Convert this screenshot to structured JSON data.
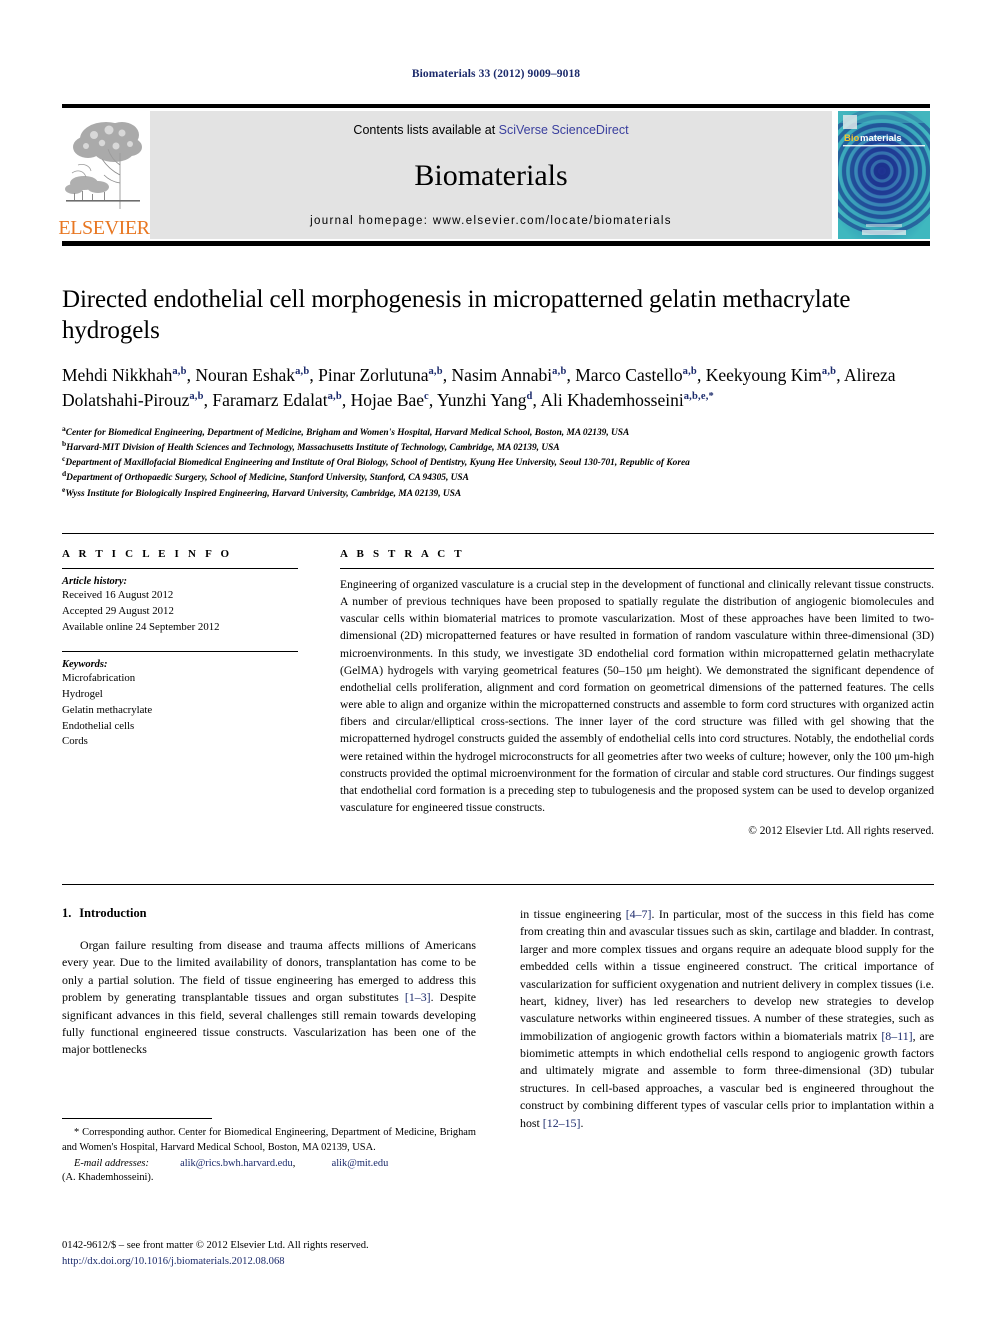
{
  "running_head": "Biomaterials 33 (2012) 9009–9018",
  "masthead": {
    "publisher_name": "ELSEVIER",
    "contents_prefix": "Contents lists available at ",
    "contents_link": "SciVerse ScienceDirect",
    "journal_wordmark": "Biomaterials",
    "homepage": "journal homepage: www.elsevier.com/locate/biomaterials",
    "cover_title_bio": "Bio",
    "cover_title_materials": "materials"
  },
  "article": {
    "title": "Directed endothelial cell morphogenesis in micropatterned gelatin methacrylate hydrogels",
    "authors": [
      {
        "name": "Mehdi Nikkhah",
        "sup": "a,b",
        "sep": ", "
      },
      {
        "name": "Nouran Eshak",
        "sup": "a,b",
        "sep": ", "
      },
      {
        "name": "Pinar Zorlutuna",
        "sup": "a,b",
        "sep": ", "
      },
      {
        "name": "Nasim Annabi",
        "sup": "a,b",
        "sep": ", "
      },
      {
        "name": "Marco Castello",
        "sup": "a,b",
        "sep": ", "
      },
      {
        "name": "Keekyoung Kim",
        "sup": "a,b",
        "sep": ", "
      },
      {
        "name": "Alireza Dolatshahi-Pirouz",
        "sup": "a,b",
        "sep": ", "
      },
      {
        "name": "Faramarz Edalat",
        "sup": "a,b",
        "sep": ", "
      },
      {
        "name": "Hojae Bae",
        "sup": "c",
        "sep": ", "
      },
      {
        "name": "Yunzhi Yang",
        "sup": "d",
        "sep": ", "
      },
      {
        "name": "Ali Khademhosseini",
        "sup": "a,b,e,*",
        "sep": ""
      }
    ],
    "affiliations": [
      {
        "mark": "a",
        "text": "Center for Biomedical Engineering, Department of Medicine, Brigham and Women's Hospital, Harvard Medical School, Boston, MA 02139, USA"
      },
      {
        "mark": "b",
        "text": "Harvard-MIT Division of Health Sciences and Technology, Massachusetts Institute of Technology, Cambridge, MA 02139, USA"
      },
      {
        "mark": "c",
        "text": "Department of Maxillofacial Biomedical Engineering and Institute of Oral Biology, School of Dentistry, Kyung Hee University, Seoul 130-701, Republic of Korea"
      },
      {
        "mark": "d",
        "text": "Department of Orthopaedic Surgery, School of Medicine, Stanford University, Stanford, CA 94305, USA"
      },
      {
        "mark": "e",
        "text": "Wyss Institute for Biologically Inspired Engineering, Harvard University, Cambridge, MA 02139, USA"
      }
    ]
  },
  "article_info": {
    "section_label": "A R T I C L E   I N F O",
    "history_heading": "Article history:",
    "history": [
      "Received 16 August 2012",
      "Accepted 29 August 2012",
      "Available online 24 September 2012"
    ],
    "keywords_heading": "Keywords:",
    "keywords": [
      "Microfabrication",
      "Hydrogel",
      "Gelatin methacrylate",
      "Endothelial cells",
      "Cords"
    ]
  },
  "abstract": {
    "section_label": "A B S T R A C T",
    "text": "Engineering of organized vasculature is a crucial step in the development of functional and clinically relevant tissue constructs. A number of previous techniques have been proposed to spatially regulate the distribution of angiogenic biomolecules and vascular cells within biomaterial matrices to promote vascularization. Most of these approaches have been limited to two-dimensional (2D) micropatterned features or have resulted in formation of random vasculature within three-dimensional (3D) microenvironments. In this study, we investigate 3D endothelial cord formation within micropatterned gelatin methacrylate (GelMA) hydrogels with varying geometrical features (50–150 μm height). We demonstrated the significant dependence of endothelial cells proliferation, alignment and cord formation on geometrical dimensions of the patterned features. The cells were able to align and organize within the micropatterned constructs and assemble to form cord structures with organized actin fibers and circular/elliptical cross-sections. The inner layer of the cord structure was filled with gel showing that the micropatterned hydrogel constructs guided the assembly of endothelial cells into cord structures. Notably, the endothelial cords were retained within the hydrogel microconstructs for all geometries after two weeks of culture; however, only the 100 μm-high constructs provided the optimal microenvironment for the formation of circular and stable cord structures. Our findings suggest that endothelial cord formation is a preceding step to tubulogenesis and the proposed system can be used to develop organized vasculature for engineered tissue constructs.",
    "copyright": "© 2012 Elsevier Ltd. All rights reserved."
  },
  "introduction": {
    "number": "1.",
    "heading": "Introduction",
    "left_paragraph_pre": "Organ failure resulting from disease and trauma affects millions of Americans every year. Due to the limited availability of donors, transplantation has come to be only a partial solution. The field of tissue engineering has emerged to address this problem by generating transplantable tissues and organ substitutes ",
    "left_ref1": "[1–3]",
    "left_paragraph_post": ". Despite significant advances in this field, several challenges still remain towards developing fully functional engineered tissue constructs. Vascularization has been one of the major bottlenecks",
    "right_pre1": "in tissue engineering ",
    "right_ref1": "[4–7]",
    "right_mid1": ". In particular, most of the success in this field has come from creating thin and avascular tissues such as skin, cartilage and bladder. In contrast, larger and more complex tissues and organs require an adequate blood supply for the embedded cells within a tissue engineered construct. The critical importance of vascularization for sufficient oxygenation and nutrient delivery in complex tissues (i.e. heart, kidney, liver) has led researchers to develop new strategies to develop vasculature networks within engineered tissues. A number of these strategies, such as immobilization of angiogenic growth factors within a biomaterials matrix ",
    "right_ref2": "[8–11]",
    "right_mid2": ", are biomimetic attempts in which endothelial cells respond to angiogenic growth factors and ultimately migrate and assemble to form three-dimensional (3D) tubular structures. In cell-based approaches, a vascular bed is engineered throughout the construct by combining different types of vascular cells prior to implantation within a host ",
    "right_ref3": "[12–15]",
    "right_end": "."
  },
  "footnotes": {
    "corresponding": "* Corresponding author. Center for Biomedical Engineering, Department of Medicine, Brigham and Women's Hospital, Harvard Medical School, Boston, MA 02139, USA.",
    "email_label": "E-mail addresses:",
    "email1": "alik@rics.bwh.harvard.edu",
    "email_sep": ",",
    "email2": "alik@mit.edu",
    "email_attrib": "(A. Khademhosseini)."
  },
  "imprint": {
    "line1": "0142-9612/$ – see front matter © 2012 Elsevier Ltd. All rights reserved.",
    "doi": "http://dx.doi.org/10.1016/j.biomaterials.2012.08.068"
  },
  "colors": {
    "link_blue": "#1b2a6b",
    "elsevier_orange": "#e87722",
    "band_grey": "#e3e3e3",
    "cover_teal": "#2e9fb0"
  }
}
